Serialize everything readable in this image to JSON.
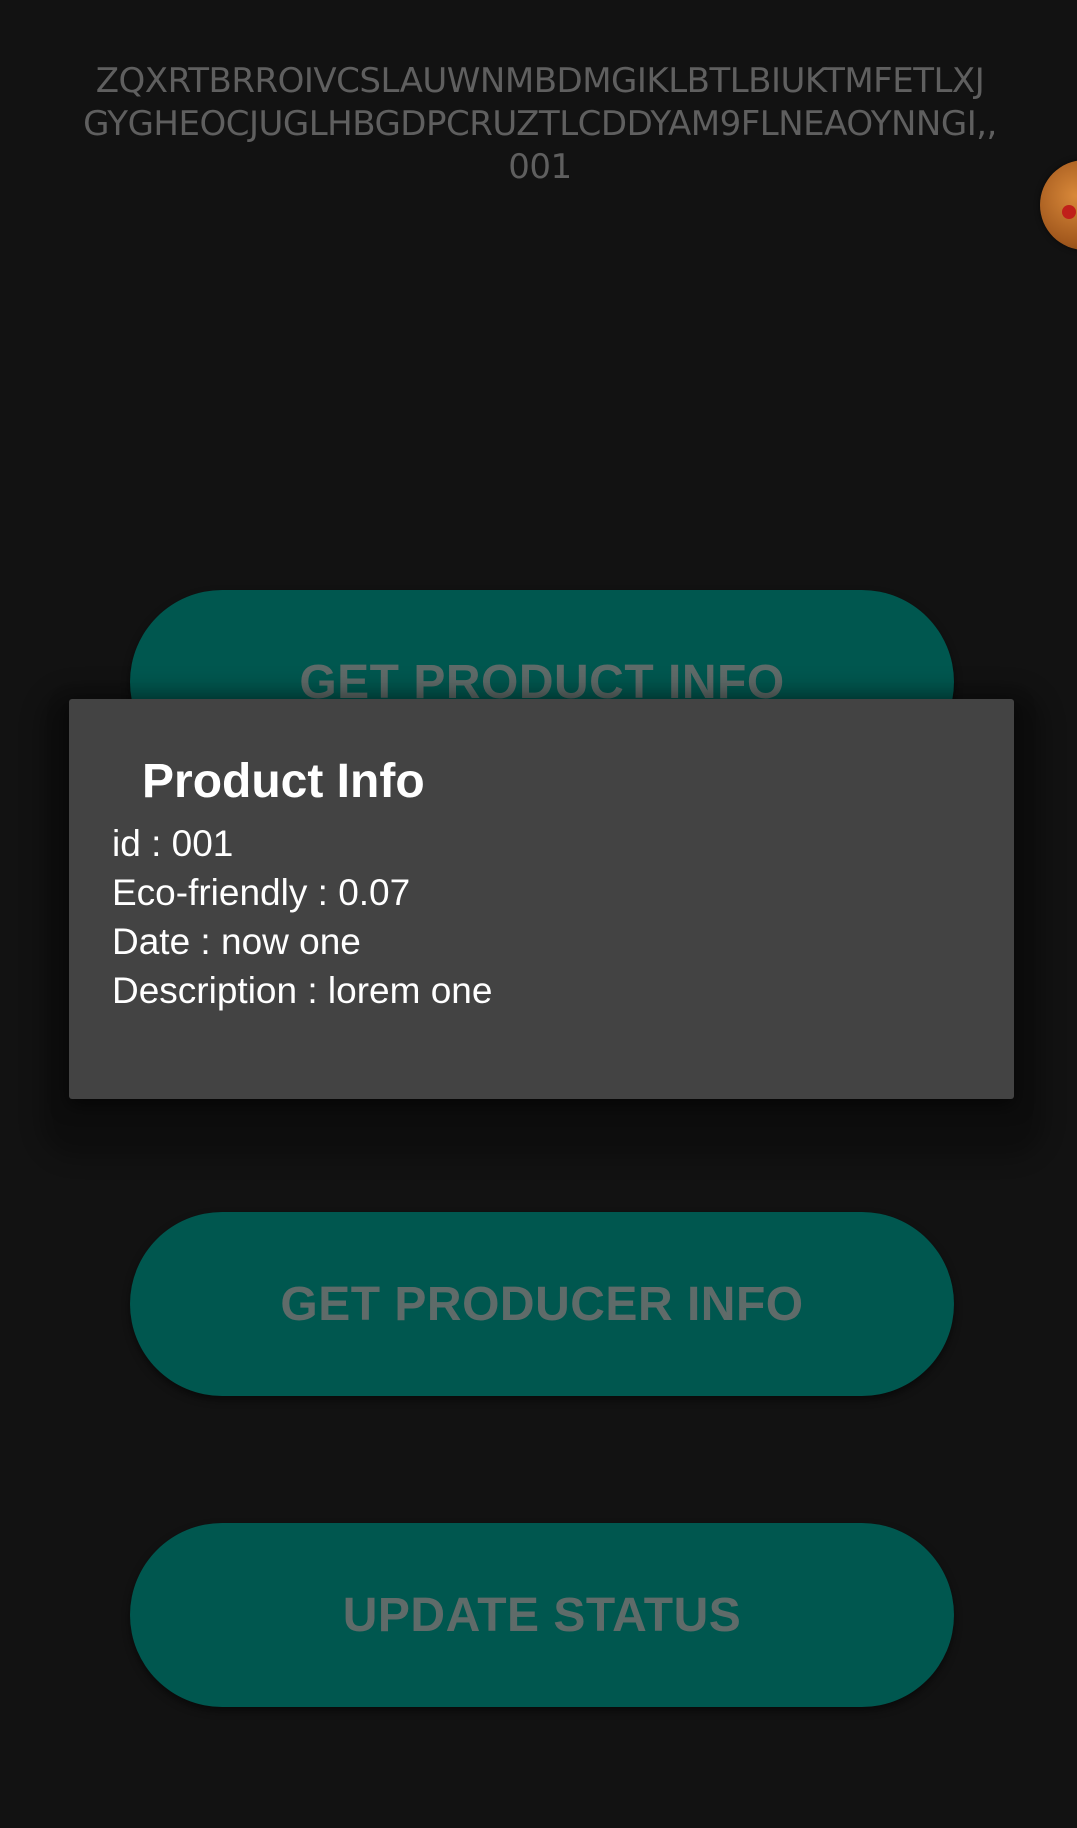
{
  "header": {
    "hash_lines": [
      "ZQXRTBRROIVCSLAUWNMBDMGIKLBTLBIUKTMFETLXJ",
      "GYGHEOCJUGLHBGDPCRUZTLCDDYAM9FLNEAOYNNGI,,",
      "001"
    ]
  },
  "buttons": {
    "product_info": "GET PRODUCT INFO",
    "producer_info": "GET PRODUCER INFO",
    "update_status": "UPDATE STATUS"
  },
  "dialog": {
    "title": "Product Info",
    "lines": [
      "id : 001",
      "Eco-friendly : 0.07",
      "Date : now one",
      "Description : lorem one"
    ]
  },
  "colors": {
    "background": "#121212",
    "button_fill": "#00574f",
    "button_text": "#5f6b69",
    "dialog_bg": "#434343",
    "dialog_text": "#ffffff",
    "hash_text": "#5f5f5f"
  },
  "icons": {
    "floating_bubble": "floating-chat-bubble-icon"
  }
}
